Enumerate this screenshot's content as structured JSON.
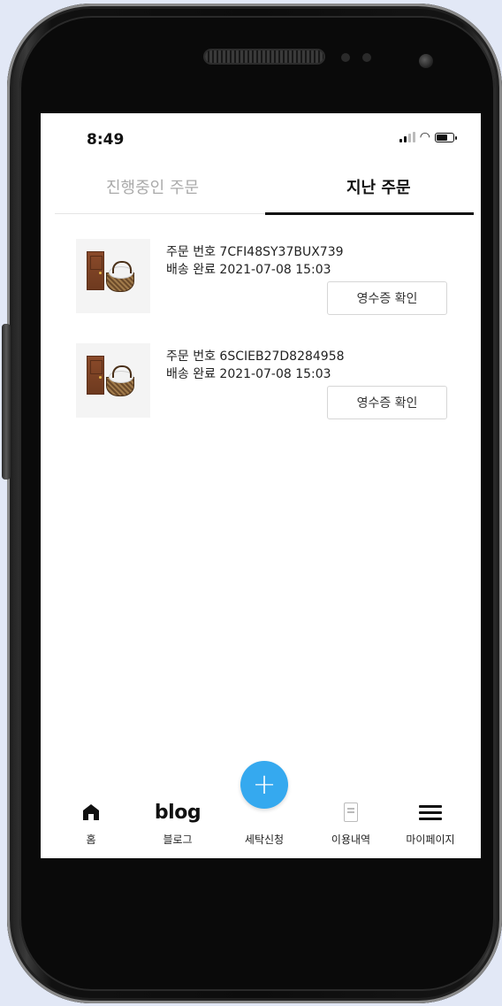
{
  "status_bar": {
    "time": "8:49"
  },
  "tabs": [
    {
      "label": "진행중인 주문",
      "active": false
    },
    {
      "label": "지난 주문",
      "active": true
    }
  ],
  "orders": [
    {
      "order_no": "주문 번호 7CFI48SY37BUX739",
      "status": "배송 완료 2021-07-08 15:03",
      "receipt_label": "영수증 확인"
    },
    {
      "order_no": "주문 번호 6SCIEB27D8284958",
      "status": "배송 완료 2021-07-08 15:03",
      "receipt_label": "영수증 확인"
    }
  ],
  "fab": {
    "icon": "plus-icon",
    "color": "#35a9ef"
  },
  "bottom_nav": [
    {
      "icon": "home-icon",
      "label": "홈"
    },
    {
      "icon_text": "blog",
      "label": "블로그"
    },
    {
      "label": "세탁신청"
    },
    {
      "icon": "document-icon",
      "label": "이용내역"
    },
    {
      "icon": "menu-icon",
      "label": "마이페이지"
    }
  ]
}
